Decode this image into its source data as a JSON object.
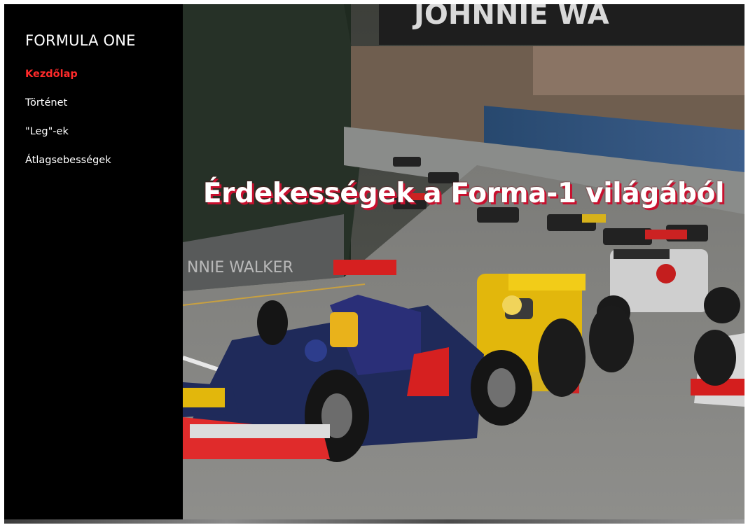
{
  "sidebar": {
    "brand": "FORMULA ONE",
    "nav": [
      {
        "label": "Kezdőlap",
        "active": true
      },
      {
        "label": "Történet",
        "active": false
      },
      {
        "label": "\"Leg\"-ek",
        "active": false
      },
      {
        "label": "Átlagsebességek",
        "active": false
      }
    ]
  },
  "hero": {
    "title": "Érdekességek a Forma-1 világából",
    "banner_text": "JOHNNIE WA",
    "wall_text": "NNIE WALKER",
    "image_subject": "Formula One cars racing on a street circuit"
  },
  "colors": {
    "sidebar_bg": "#000000",
    "nav_active": "#ff2a2a",
    "nav_text": "#ffffff",
    "title_shadow": "#c8102e"
  }
}
